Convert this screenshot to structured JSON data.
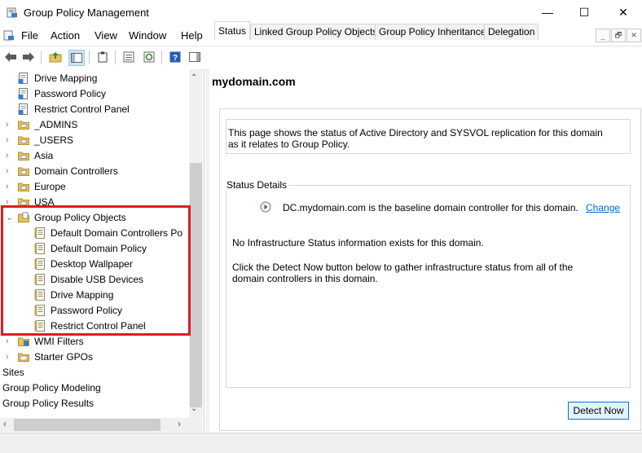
{
  "window": {
    "title": "Group Policy Management",
    "minimize": "—",
    "maximize": "☐",
    "close": "✕"
  },
  "menu": {
    "items": [
      "File",
      "Action",
      "View",
      "Window",
      "Help"
    ],
    "mdi": [
      "_",
      "🗗",
      "✕"
    ]
  },
  "tree": {
    "rows": [
      {
        "label": "Drive Mapping",
        "icon": "policy-doc-icon"
      },
      {
        "label": "Password Policy",
        "icon": "policy-doc-icon"
      },
      {
        "label": "Restrict Control Panel",
        "icon": "policy-doc-icon"
      },
      {
        "label": "_ADMINS",
        "icon": "ou-folder-icon"
      },
      {
        "label": "_USERS",
        "icon": "ou-folder-icon"
      },
      {
        "label": "Asia",
        "icon": "ou-folder-icon"
      },
      {
        "label": "Domain Controllers",
        "icon": "ou-folder-icon"
      },
      {
        "label": "Europe",
        "icon": "ou-folder-icon"
      },
      {
        "label": "USA",
        "icon": "ou-folder-icon"
      },
      {
        "label": "Group Policy Objects",
        "icon": "gpo-folder-icon"
      },
      {
        "label": "Default Domain Controllers Po",
        "icon": "gpo-icon"
      },
      {
        "label": "Default Domain Policy",
        "icon": "gpo-icon"
      },
      {
        "label": "Desktop Wallpaper",
        "icon": "gpo-icon"
      },
      {
        "label": "Disable USB Devices",
        "icon": "gpo-icon"
      },
      {
        "label": "Drive Mapping",
        "icon": "gpo-icon"
      },
      {
        "label": "Password Policy",
        "icon": "gpo-icon"
      },
      {
        "label": "Restrict Control Panel",
        "icon": "gpo-icon"
      },
      {
        "label": "WMI Filters",
        "icon": "wmi-folder-icon"
      },
      {
        "label": "Starter GPOs",
        "icon": "starter-gpo-icon"
      },
      {
        "label": "Sites",
        "icon": ""
      },
      {
        "label": "Group Policy Modeling",
        "icon": ""
      },
      {
        "label": "Group Policy Results",
        "icon": ""
      }
    ]
  },
  "right": {
    "heading": "mydomain.com",
    "tabs": [
      "Status",
      "Linked Group Policy Objects",
      "Group Policy Inheritance",
      "Delegation"
    ],
    "intro": "This page shows the status of Active Directory and SYSVOL replication for this domain as it relates to Group Policy.",
    "status_details_label": "Status Details",
    "baseline_text": "DC.mydomain.com is the baseline domain controller for this domain.",
    "change_link": "Change",
    "no_info": "No Infrastructure Status information exists for this domain.",
    "detect_hint": "Click the Detect Now button below to gather infrastructure status from all of the domain controllers in this domain.",
    "detect_button": "Detect Now"
  },
  "colors": {
    "highlight_box": "#e01b24",
    "link": "#0066cc",
    "button_border": "#0078d7"
  }
}
